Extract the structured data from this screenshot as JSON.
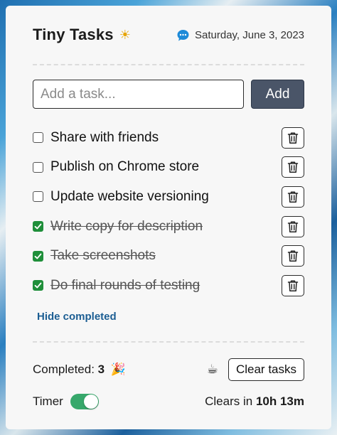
{
  "header": {
    "title": "Tiny Tasks",
    "title_icon": "sun-icon",
    "date_icon": "chat-bubble-icon",
    "date": "Saturday, June 3, 2023"
  },
  "add_form": {
    "placeholder": "Add a task...",
    "value": "",
    "add_label": "Add"
  },
  "tasks": [
    {
      "label": "Share with friends",
      "done": false
    },
    {
      "label": "Publish on Chrome store",
      "done": false
    },
    {
      "label": "Update website versioning",
      "done": false
    },
    {
      "label": "Write copy for description",
      "done": true
    },
    {
      "label": "Take screenshots",
      "done": true
    },
    {
      "label": "Do final rounds of testing",
      "done": true
    }
  ],
  "hide_completed_label": "Hide completed",
  "footer": {
    "completed_label": "Completed:",
    "completed_count": "3",
    "completed_icon": "party-popper-icon",
    "coffee_icon": "coffee-icon",
    "clear_label": "Clear tasks",
    "timer_label": "Timer",
    "timer_on": true,
    "clears_label": "Clears in",
    "clears_value": "10h 13m"
  },
  "colors": {
    "accent_button": "#4a5568",
    "checkbox_checked": "#1f8f3a",
    "toggle_on": "#37a86b",
    "link": "#1c5e93"
  }
}
